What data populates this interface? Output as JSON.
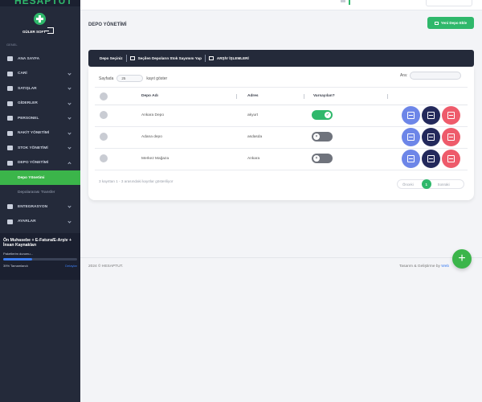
{
  "sidebar": {
    "brand": "HESAPTUT",
    "profile_name": "GÜLER SOFT",
    "section_label": "GENEL",
    "items": [
      {
        "label": "ANA SAYFA",
        "icon": "home-icon",
        "chevron": false
      },
      {
        "label": "CARİ",
        "icon": "users-icon",
        "chevron": true
      },
      {
        "label": "SATIŞLAR",
        "icon": "cart-icon",
        "chevron": true
      },
      {
        "label": "GİDERLER",
        "icon": "expense-icon",
        "chevron": true
      },
      {
        "label": "PERSONEL",
        "icon": "personnel-icon",
        "chevron": true
      },
      {
        "label": "NAKİT YÖNETİMİ",
        "icon": "cash-icon",
        "chevron": true
      },
      {
        "label": "STOK YÖNETİMİ",
        "icon": "stock-icon",
        "chevron": true
      },
      {
        "label": "DEPO YÖNETİMİ",
        "icon": "warehouse-icon",
        "chevron": true
      }
    ],
    "sub_items": [
      {
        "label": "Depo Yönetimi",
        "active": true
      },
      {
        "label": "Depolararası Transfer",
        "active": false
      }
    ],
    "items_after": [
      {
        "label": "ENTEGRASYON",
        "icon": "integration-icon",
        "chevron": true
      },
      {
        "label": "AYARLAR",
        "icon": "settings-icon",
        "chevron": true
      }
    ],
    "promo": {
      "title": "Ön Muhasebe + E-Fatura/E-Arşiv + İnsan Kaynakları",
      "status": "Paketlerim durumu...",
      "progress": 0.39,
      "done_label": "39% Tamamlandı",
      "details_label": "Detaylar"
    }
  },
  "main": {
    "page_title": "DEPO YÖNETİMİ",
    "new_button": "Yeni Depo Ekle",
    "toolbar": {
      "items": [
        "Depo Seçiniz",
        "Seçilen Depoların Stok Sayımını Yap",
        "ARŞİV İŞLEMLERİ"
      ]
    },
    "length": {
      "prefix": "Sayfada",
      "value": "25",
      "suffix": "kayıt göster"
    },
    "search": {
      "label": "Ara:",
      "placeholder": ""
    },
    "table": {
      "columns": [
        "Depo Adı",
        "Adres",
        "Varsayılan?"
      ],
      "rows": [
        {
          "name": "Ankara Depo",
          "address": "akyurt",
          "default": true
        },
        {
          "name": "Adana depo",
          "address": "asdasda",
          "default": false
        },
        {
          "name": "Merkez Mağaza",
          "address": "Ankara",
          "default": false
        }
      ]
    },
    "info": "3 kayıttan 1 - 3 arasındaki kayıtlar gösteriliyor",
    "pager": {
      "prev": "Önceki",
      "current": "1",
      "next": "Sonraki"
    },
    "footer": {
      "left": "2024 © HESAPTUT.",
      "right_prefix": "Tasarım & Geliştirme by",
      "right_brand": "Web"
    },
    "fab": "+"
  }
}
